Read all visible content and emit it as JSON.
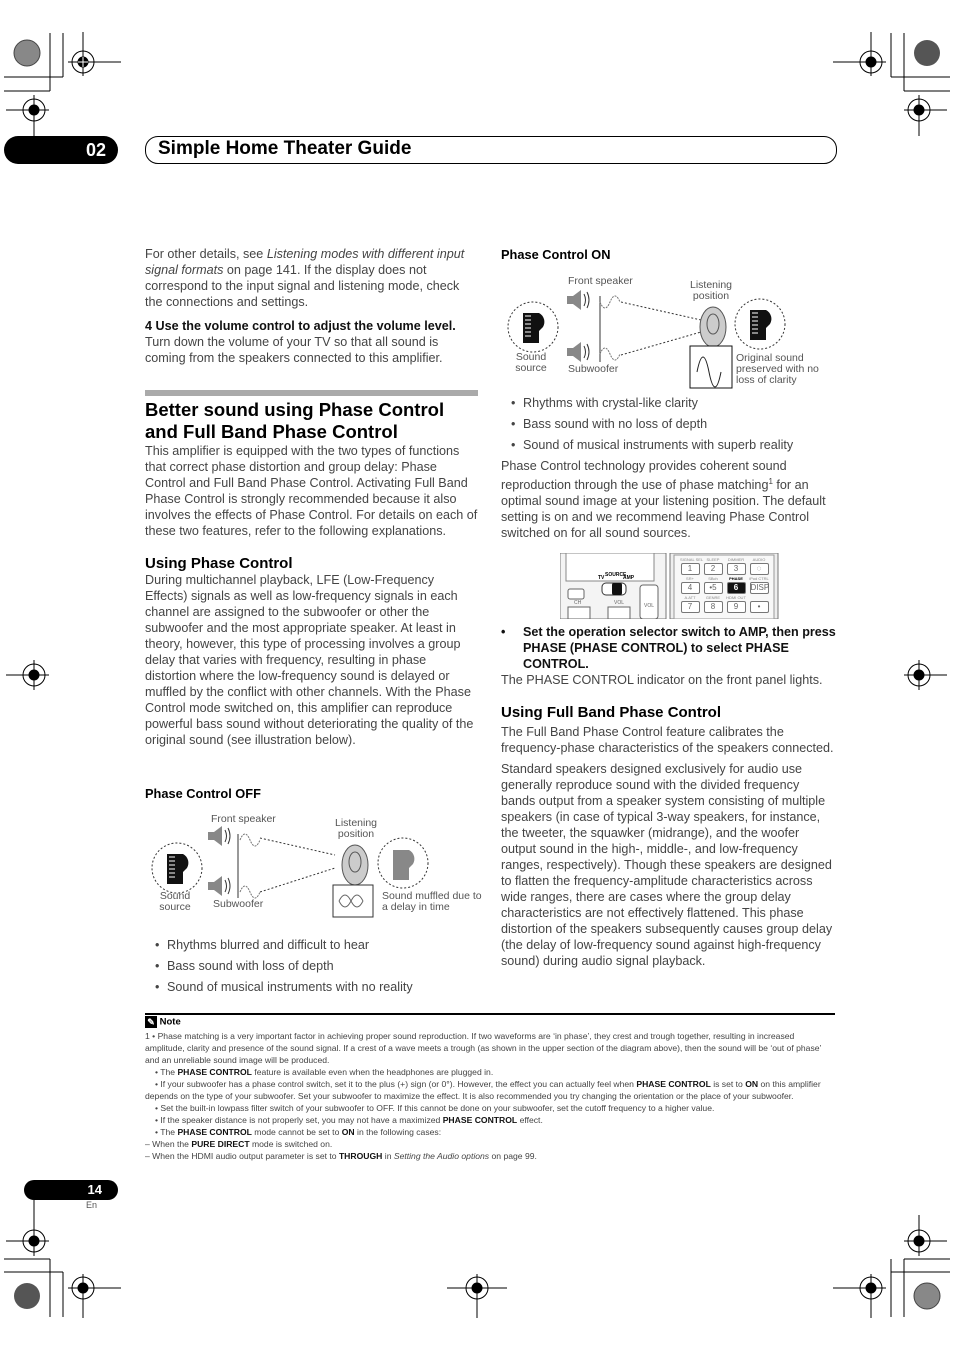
{
  "header": {
    "chapter_number": "02",
    "chapter_title": "Simple Home Theater Guide"
  },
  "left_column": {
    "intro_prefix": "For other details, see ",
    "intro_link": "Listening modes with different input signal formats",
    "intro_suffix": " on page 141. If the display does not correspond to the input signal and listening mode, check the connections and settings.",
    "step4_heading": "4   Use the volume control to adjust the volume level.",
    "step4_text": "Turn down the volume of your TV so that all sound is coming from the speakers connected to this amplifier.",
    "section_title": "Better sound using Phase Control and Full Band Phase Control",
    "section_text": "This amplifier is equipped with the two types of functions that correct phase distortion and group delay: Phase Control and Full Band Phase Control. Activating Full Band Phase Control is strongly recommended because it also involves the effects of Phase Control. For details on each of these two features, refer to the following explanations.",
    "using_phase_heading": "Using Phase Control",
    "using_phase_text": "During multichannel playback, LFE (Low-Frequency Effects) signals as well as low-frequency signals in each channel are assigned to the subwoofer or other the subwoofer and the most appropriate speaker. At least in theory, however, this type of processing involves a group delay that varies with frequency, resulting in phase distortion where the low-frequency sound is delayed or muffled by the conflict with other channels. With the Phase Control mode switched on, this amplifier can reproduce powerful bass sound without deteriorating the quality of the original sound (see illustration below).",
    "phase_off": {
      "heading": "Phase Control OFF",
      "labels": {
        "front_speaker": "Front speaker",
        "listening_position": "Listening position",
        "sound_source": "Sound source",
        "subwoofer": "Subwoofer",
        "result": "Sound muffled due to a delay in time"
      },
      "bullets": [
        "Rhythms blurred and difficult to hear",
        "Bass sound with loss of depth",
        "Sound of musical instruments with no reality"
      ]
    }
  },
  "right_column": {
    "phase_on": {
      "heading": "Phase Control ON",
      "labels": {
        "front_speaker": "Front speaker",
        "listening_position": "Listening position",
        "sound_source": "Sound source",
        "subwoofer": "Subwoofer",
        "result": "Original sound preserved with no loss of clarity"
      },
      "bullets": [
        "Rhythms with crystal-like clarity",
        "Bass sound with no loss of depth",
        "Sound of musical instruments with superb reality"
      ]
    },
    "tech_text_a": "Phase Control technology provides coherent sound reproduction through the use of phase matching",
    "tech_sup": "1",
    "tech_text_b": " for an optimal sound image at your listening position. The default setting is on and we recommend leaving Phase Control switched on for all sound sources.",
    "remote": {
      "switch_labels": {
        "tv": "TV",
        "source": "SOURCE",
        "amp": "AMP"
      },
      "left_labels": {
        "ch": "CH",
        "vol": "VOL",
        "vol_side": "VOL"
      },
      "keys": [
        {
          "top": "SIGNAL SEL",
          "label": "1"
        },
        {
          "top": "SLEEP",
          "label": "2"
        },
        {
          "top": "DIMMER",
          "label": "3"
        },
        {
          "top": "AUDIO",
          "label": "◌"
        },
        {
          "top": "SR+",
          "label": "4"
        },
        {
          "top": "SBch",
          "label": "•5"
        },
        {
          "top": "PHASE",
          "label": "6"
        },
        {
          "top": "iPod CTRL",
          "label": "DISP"
        },
        {
          "top": "A.ATT",
          "label": "7"
        },
        {
          "top": "GENRE",
          "label": "8"
        },
        {
          "top": "HDMI OUT",
          "label": "9"
        },
        {
          "top": "",
          "label": "•"
        }
      ]
    },
    "instruction": "Set the operation selector switch to AMP, then press PHASE (PHASE CONTROL) to select PHASE CONTROL.",
    "instruction_result": "The PHASE CONTROL indicator on the front panel lights.",
    "full_band_heading": "Using Full Band Phase Control",
    "full_band_p1": "The Full Band Phase Control feature calibrates the frequency-phase characteristics of the speakers connected.",
    "full_band_p2": "Standard speakers designed exclusively for audio use generally reproduce sound with the divided frequency bands output from a speaker system consisting of multiple speakers (in case of typical 3-way speakers, for instance, the tweeter, the squawker (midrange), and the woofer output sound in the high-, middle-, and low-frequency ranges, respectively). Though these speakers are designed to flatten the frequency-amplitude characteristics across wide ranges, there are cases where the group delay characteristics are not effectively flattened. This phase distortion of the speakers subsequently causes group delay (the delay of low-frequency sound against high-frequency sound) during audio signal playback."
  },
  "note": {
    "title": "Note",
    "n1_a": "1  • Phase matching is a very important factor in achieving proper sound reproduction. If two waveforms are ‘in phase’, they crest and trough together, resulting in increased amplitude, clarity and presence of the sound signal. If a crest of a wave meets a trough (as shown in the upper section of the diagram above), then the sound will be ‘out of phase’ and an unreliable sound image will be produced.",
    "n2_a": "• The ",
    "n2_b": "PHASE CONTROL",
    "n2_c": " feature is available even when the headphones are plugged in.",
    "n3_a": "• If your subwoofer has a phase control switch, set it to the plus (+) sign (or 0°). However, the effect you can actually feel when ",
    "n3_b": "PHASE CONTROL",
    "n3_c": " is set to ",
    "n3_d": "ON",
    "n3_e": " on this amplifier depends on the type of your subwoofer. Set your subwoofer to maximize the effect. It is also recommended you try changing the orientation or the place of your subwoofer.",
    "n4": "• Set the built-in lowpass filter switch of your subwoofer to OFF. If this cannot be done on your subwoofer, set the cutoff frequency to a higher value.",
    "n5_a": "• If the speaker distance is not properly set, you may not have a maximized ",
    "n5_b": "PHASE CONTROL",
    "n5_c": " effect.",
    "n6_a": "• The ",
    "n6_b": "PHASE CONTROL",
    "n6_c": " mode cannot be set to ",
    "n6_d": "ON",
    "n6_e": " in the following cases:",
    "n7_a": "– When the ",
    "n7_b": "PURE DIRECT",
    "n7_c": " mode is switched on.",
    "n8_a": "– When the HDMI audio output parameter is set to ",
    "n8_b": "THROUGH",
    "n8_c": " in ",
    "n8_d": "Setting the Audio options",
    "n8_e": " on page 99."
  },
  "footer": {
    "page_number": "14",
    "language": "En"
  }
}
